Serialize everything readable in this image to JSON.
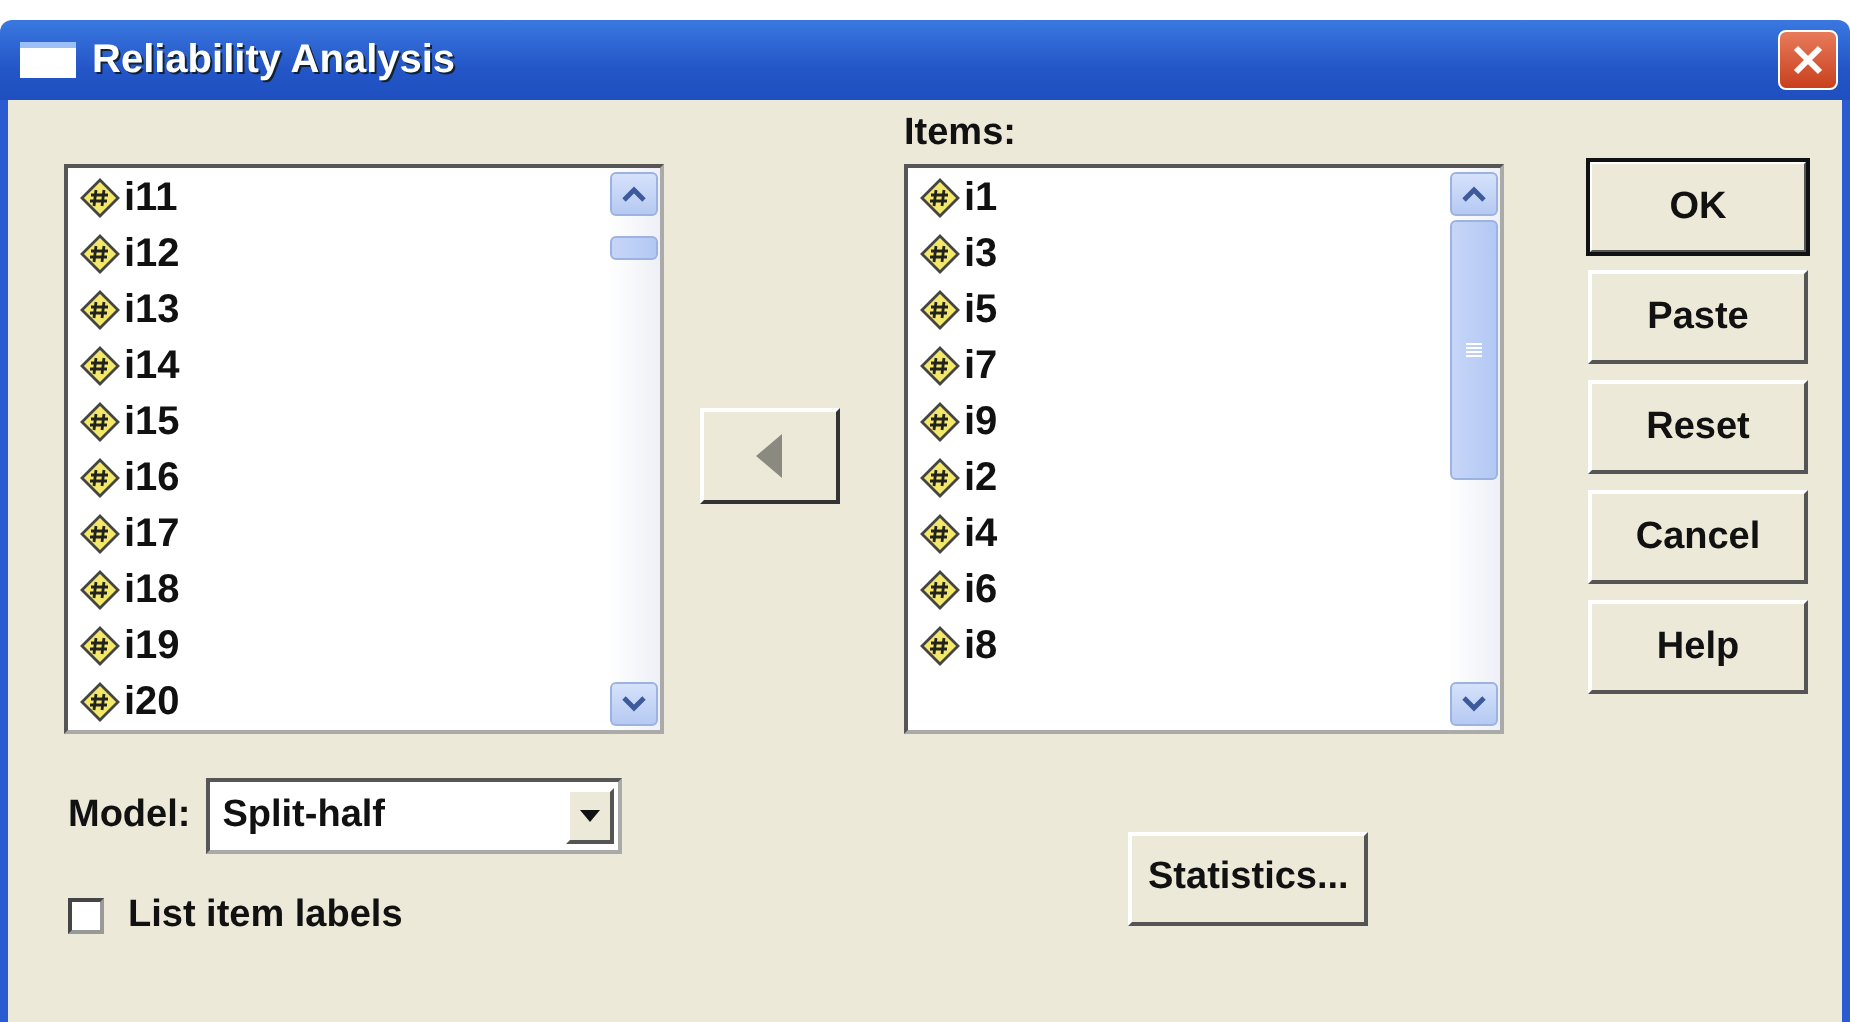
{
  "window": {
    "title": "Reliability Analysis"
  },
  "variables": {
    "items": [
      "i11",
      "i12",
      "i13",
      "i14",
      "i15",
      "i16",
      "i17",
      "i18",
      "i19",
      "i20"
    ]
  },
  "items_list": {
    "label": "Items:",
    "items": [
      "i1",
      "i3",
      "i5",
      "i7",
      "i9",
      "i2",
      "i4",
      "i6",
      "i8"
    ]
  },
  "buttons": [
    {
      "label": "OK",
      "default": true
    },
    {
      "label": "Paste",
      "default": false
    },
    {
      "label": "Reset",
      "default": false
    },
    {
      "label": "Cancel",
      "default": false
    },
    {
      "label": "Help",
      "default": false
    }
  ],
  "model": {
    "label": "Model:",
    "value": "Split-half"
  },
  "list_item_labels": {
    "label": "List item labels",
    "checked": false
  },
  "statistics_button": {
    "label": "Statistics..."
  }
}
